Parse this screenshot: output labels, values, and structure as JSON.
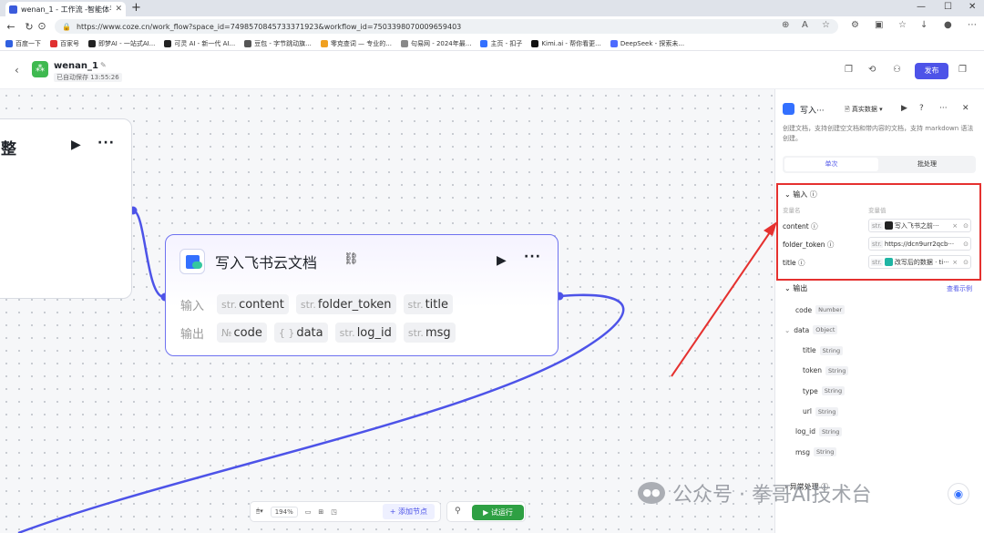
{
  "browser": {
    "tab_title": "wenan_1 - 工作流 -智能体平台",
    "url": "https://www.coze.cn/work_flow?space_id=7498570845733371923&workflow_id=7503398070009659403",
    "bookmarks": [
      {
        "label": "百度一下",
        "color": "#3060e0"
      },
      {
        "label": "百家号",
        "color": "#e03030"
      },
      {
        "label": "即梦AI - 一站式AI...",
        "color": "#222222"
      },
      {
        "label": "可灵 AI - 新一代 AI...",
        "color": "#222222"
      },
      {
        "label": "豆包 - 字节跳动旗...",
        "color": "#555555"
      },
      {
        "label": "零克查词 — 专业的...",
        "color": "#f0a020"
      },
      {
        "label": "句易网 - 2024年最...",
        "color": "#888888"
      },
      {
        "label": "主页 - 扣子",
        "color": "#3370ff"
      },
      {
        "label": "Kimi.ai - 帮你看更...",
        "color": "#111111"
      },
      {
        "label": "DeepSeek - 探索未...",
        "color": "#4d6bfe"
      }
    ]
  },
  "header": {
    "app_name": "wenan_1",
    "saved": "已自动保存 13:55:26",
    "publish": "发布"
  },
  "canvas": {
    "left_node": {
      "title_fragment": "整"
    },
    "node": {
      "title": "写入飞书云文档",
      "input_label": "输入",
      "output_label": "输出",
      "inputs": [
        {
          "type": "str.",
          "name": "content"
        },
        {
          "type": "str.",
          "name": "folder_token"
        },
        {
          "type": "str.",
          "name": "title"
        }
      ],
      "outputs": [
        {
          "type": "№",
          "name": "code"
        },
        {
          "type": "{ }",
          "name": "data"
        },
        {
          "type": "str.",
          "name": "log_id"
        },
        {
          "type": "str.",
          "name": "msg"
        }
      ]
    },
    "toolbar": {
      "zoom": "194%",
      "add_node": "+ 添加节点",
      "run": "试运行"
    }
  },
  "panel": {
    "title": "写入···",
    "mode": "真实数据",
    "description": "创建文档，支持创建空文档和带内容的文档，支持 markdown 语法创建。",
    "tabs": {
      "single": "单次",
      "batch": "批处理"
    },
    "input": {
      "heading": "输入",
      "col_name": "变量名",
      "col_value": "变量值",
      "rows": [
        {
          "name": "content",
          "type": "str.",
          "ref": "写入飞书之前···",
          "badge_color": "#222222"
        },
        {
          "name": "folder_token",
          "type": "str.",
          "ref": "https://dcn9urr2qcb···",
          "badge_color": ""
        },
        {
          "name": "title",
          "type": "str.",
          "ref": "改写后的数据 · ti···",
          "badge_color": "#1fb5a4"
        }
      ]
    },
    "output": {
      "heading": "输出",
      "view_example": "查看示例",
      "rows": [
        {
          "name": "code",
          "type": "Number",
          "indent": 0
        },
        {
          "name": "data",
          "type": "Object",
          "indent": 0,
          "expand": true
        },
        {
          "name": "title",
          "type": "String",
          "indent": 1
        },
        {
          "name": "token",
          "type": "String",
          "indent": 1
        },
        {
          "name": "type",
          "type": "String",
          "indent": 1
        },
        {
          "name": "url",
          "type": "String",
          "indent": 1
        },
        {
          "name": "log_id",
          "type": "String",
          "indent": 0
        },
        {
          "name": "msg",
          "type": "String",
          "indent": 0
        }
      ]
    },
    "exception": "异常处理"
  },
  "watermark": "公众号 · 拳哥AI技术台"
}
